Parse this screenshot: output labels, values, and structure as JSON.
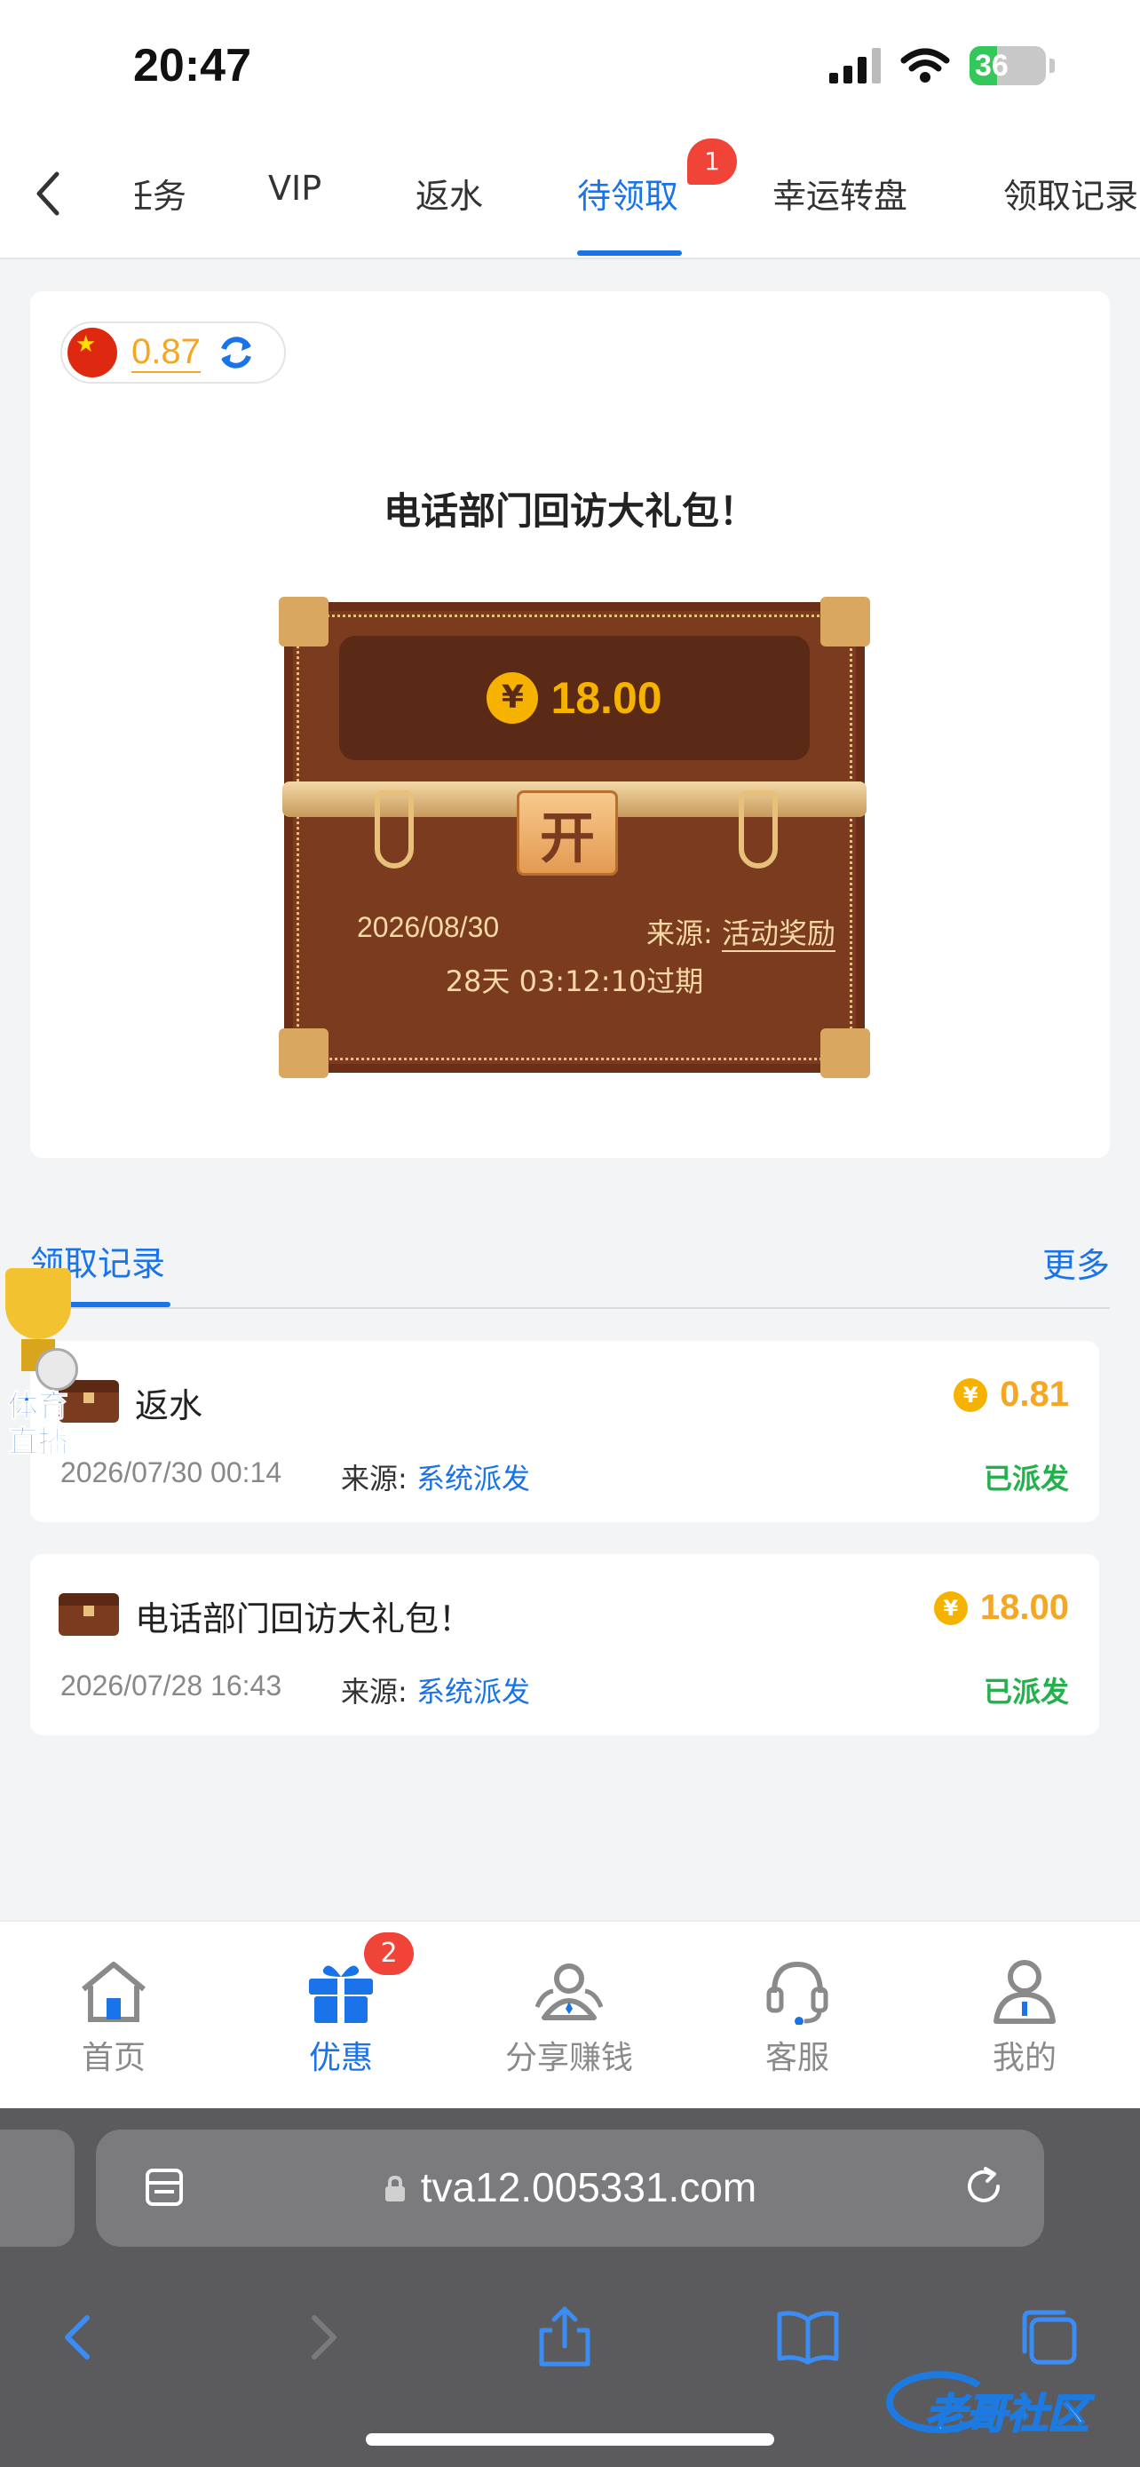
{
  "status_bar": {
    "time": "20:47",
    "battery": "36",
    "battery_level": 0.36
  },
  "tabs": [
    {
      "label": "任务"
    },
    {
      "label": "VIP"
    },
    {
      "label": "返水"
    },
    {
      "label": "待领取"
    },
    {
      "label": "幸运转盘"
    },
    {
      "label": "领取记录"
    }
  ],
  "active_tab": "待领取",
  "tab_badge": "1",
  "balance": "0.87",
  "gift": {
    "title": "电话部门回访大礼包！",
    "amount": "18.00",
    "currency_symbol": "¥",
    "open_label": "开",
    "date": "2026/08/30",
    "source_label": "来源: ",
    "source_value": "活动奖励",
    "expire": "28天 03:12:10过期"
  },
  "records": {
    "title": "领取记录",
    "more": "更多",
    "items": [
      {
        "name": "返水",
        "amount": "0.81",
        "date": "2026/07/30 00:14",
        "source_label": "来源: ",
        "source": "系统派发",
        "status": "已派发"
      },
      {
        "name": "电话部门回访大礼包！",
        "amount": "18.00",
        "date": "2026/07/28 16:43",
        "source_label": "来源: ",
        "source": "系统派发",
        "status": "已派发"
      }
    ]
  },
  "floating_widget": {
    "line1": "体育",
    "line2": "直播"
  },
  "bottom_nav": {
    "items": [
      {
        "label": "首页",
        "icon": "home-icon"
      },
      {
        "label": "优惠",
        "icon": "gift-icon"
      },
      {
        "label": "分享赚钱",
        "icon": "share-users-icon"
      },
      {
        "label": "客服",
        "icon": "headset-icon"
      },
      {
        "label": "我的",
        "icon": "user-icon"
      }
    ],
    "active": "优惠",
    "badge": "2"
  },
  "browser": {
    "url": "tva12.005331.com"
  },
  "watermark": "老哥社区",
  "colors": {
    "accent": "#1a73e8",
    "gold": "#f5a623",
    "success": "#22b14c",
    "badge": "#f04438",
    "chest": "#7a3b1f"
  }
}
